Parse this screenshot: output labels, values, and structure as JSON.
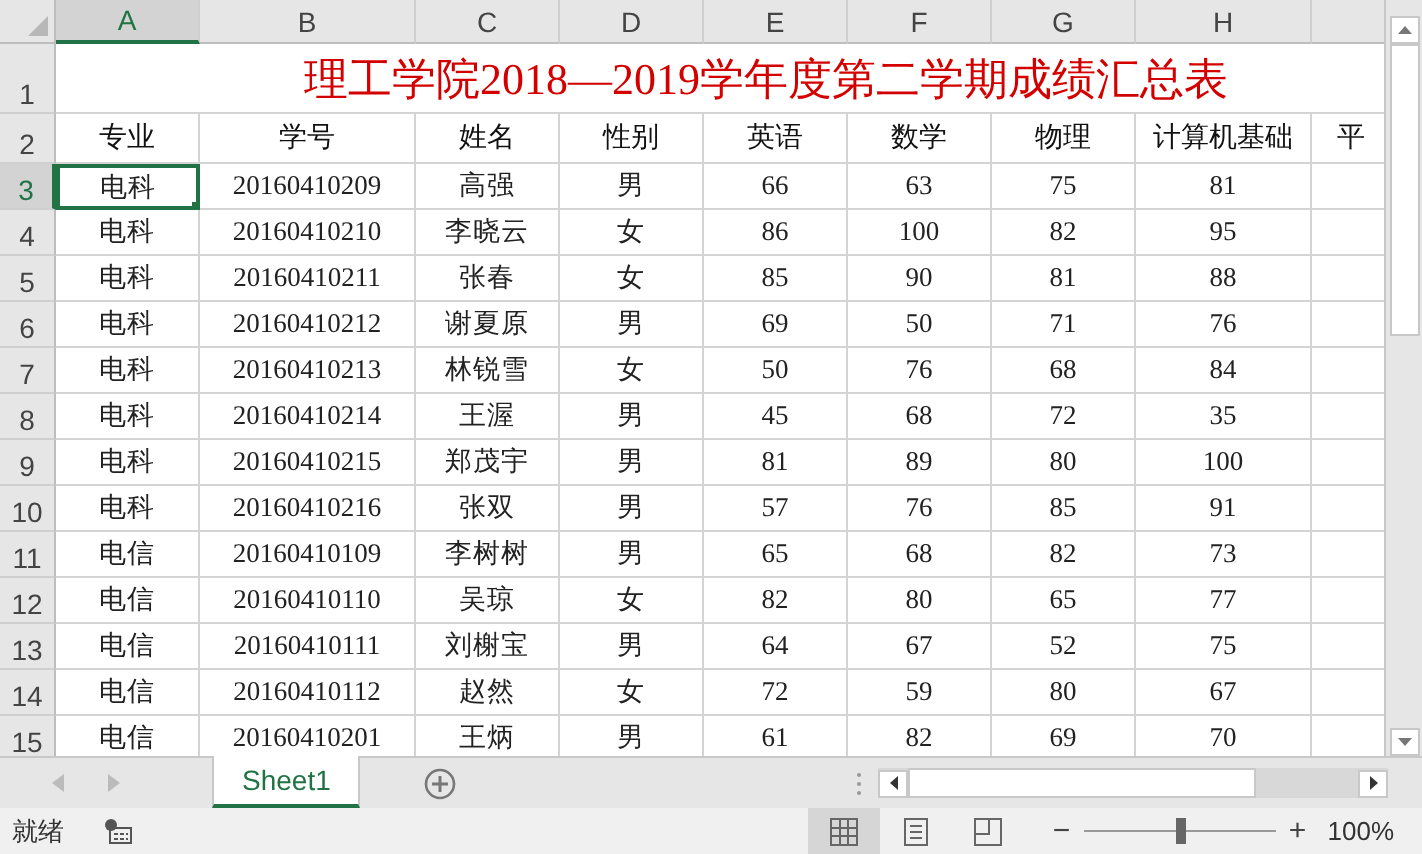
{
  "columns": [
    {
      "letter": "A",
      "selected": true
    },
    {
      "letter": "B",
      "selected": false
    },
    {
      "letter": "C",
      "selected": false
    },
    {
      "letter": "D",
      "selected": false
    },
    {
      "letter": "E",
      "selected": false
    },
    {
      "letter": "F",
      "selected": false
    },
    {
      "letter": "G",
      "selected": false
    },
    {
      "letter": "H",
      "selected": false
    }
  ],
  "title_row": {
    "number": "1",
    "title": "理工学院2018—2019学年度第二学期成绩汇总表"
  },
  "header_row": {
    "number": "2",
    "cells": [
      "专业",
      "学号",
      "姓名",
      "性别",
      "英语",
      "数学",
      "物理",
      "计算机基础",
      "平"
    ]
  },
  "rows": [
    {
      "number": "3",
      "selected": true,
      "cells": [
        "电科",
        "20160410209",
        "高强",
        "男",
        "66",
        "63",
        "75",
        "81"
      ]
    },
    {
      "number": "4",
      "selected": false,
      "cells": [
        "电科",
        "20160410210",
        "李晓云",
        "女",
        "86",
        "100",
        "82",
        "95"
      ]
    },
    {
      "number": "5",
      "selected": false,
      "cells": [
        "电科",
        "20160410211",
        "张春",
        "女",
        "85",
        "90",
        "81",
        "88"
      ]
    },
    {
      "number": "6",
      "selected": false,
      "cells": [
        "电科",
        "20160410212",
        "谢夏原",
        "男",
        "69",
        "50",
        "71",
        "76"
      ]
    },
    {
      "number": "7",
      "selected": false,
      "cells": [
        "电科",
        "20160410213",
        "林锐雪",
        "女",
        "50",
        "76",
        "68",
        "84"
      ]
    },
    {
      "number": "8",
      "selected": false,
      "cells": [
        "电科",
        "20160410214",
        "王渥",
        "男",
        "45",
        "68",
        "72",
        "35"
      ]
    },
    {
      "number": "9",
      "selected": false,
      "cells": [
        "电科",
        "20160410215",
        "郑茂宇",
        "男",
        "81",
        "89",
        "80",
        "100"
      ]
    },
    {
      "number": "10",
      "selected": false,
      "cells": [
        "电科",
        "20160410216",
        "张双",
        "男",
        "57",
        "76",
        "85",
        "91"
      ]
    },
    {
      "number": "11",
      "selected": false,
      "cells": [
        "电信",
        "20160410109",
        "李树树",
        "男",
        "65",
        "68",
        "82",
        "73"
      ]
    },
    {
      "number": "12",
      "selected": false,
      "cells": [
        "电信",
        "20160410110",
        "吴琼",
        "女",
        "82",
        "80",
        "65",
        "77"
      ]
    },
    {
      "number": "13",
      "selected": false,
      "cells": [
        "电信",
        "20160410111",
        "刘榭宝",
        "男",
        "64",
        "67",
        "52",
        "75"
      ]
    },
    {
      "number": "14",
      "selected": false,
      "cells": [
        "电信",
        "20160410112",
        "赵然",
        "女",
        "72",
        "59",
        "80",
        "67"
      ]
    },
    {
      "number": "15",
      "selected": false,
      "cells": [
        "电信",
        "20160410201",
        "王炳",
        "男",
        "61",
        "82",
        "69",
        "70"
      ]
    }
  ],
  "sheet_tabs": [
    {
      "label": "Sheet1",
      "selected": true
    }
  ],
  "status_bar": {
    "status": "就绪",
    "views": [
      {
        "kind": "normal",
        "selected": true
      },
      {
        "kind": "layout",
        "selected": false
      },
      {
        "kind": "pagebreak",
        "selected": false
      }
    ],
    "zoom": {
      "minus": "−",
      "plus": "+",
      "level": 0.5,
      "reading": "100%"
    }
  }
}
